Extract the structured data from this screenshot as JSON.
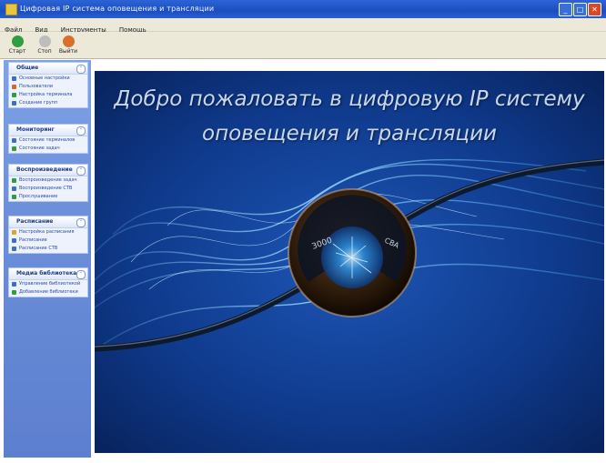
{
  "window": {
    "title": "Цифровая IP система оповещения и трансляции",
    "controls": [
      "minimize",
      "maximize",
      "close"
    ]
  },
  "menu": [
    "Файл",
    "Вид",
    "Инструменты",
    "Помощь"
  ],
  "toolbar": [
    {
      "label": "Старт",
      "icon": "start-icon",
      "color": "#2e9e3e"
    },
    {
      "label": "Стоп",
      "icon": "stop-icon",
      "color": "#b9b9b9"
    },
    {
      "label": "Выйти",
      "icon": "exit-icon",
      "color": "#d9702a"
    }
  ],
  "sidebar": {
    "panels": [
      {
        "title": "Общие",
        "items": [
          {
            "label": "Основные настройки",
            "color": "#3a6fd0"
          },
          {
            "label": "Пользователи",
            "color": "#d36a2a"
          },
          {
            "label": "Настройка терминала",
            "color": "#2e9e3e"
          },
          {
            "label": "Создание групп",
            "color": "#3a6fd0"
          }
        ]
      },
      {
        "title": "Мониторинг",
        "items": [
          {
            "label": "Состояние терминалов",
            "color": "#3a6fd0"
          },
          {
            "label": "Состояние задач",
            "color": "#2e9e3e"
          }
        ]
      },
      {
        "title": "Воспроизведение",
        "items": [
          {
            "label": "Воспроизведение задач",
            "color": "#2e9e3e"
          },
          {
            "label": "Воспроизведение СТВ",
            "color": "#3a6fd0"
          },
          {
            "label": "Прослушивание",
            "color": "#2e9e3e"
          }
        ]
      },
      {
        "title": "Расписание",
        "items": [
          {
            "label": "Настройка расписания",
            "color": "#d9a52a"
          },
          {
            "label": "Расписание",
            "color": "#3a6fd0"
          },
          {
            "label": "Расписание СТВ",
            "color": "#3a6fd0"
          }
        ]
      },
      {
        "title": "Медиа библиотека",
        "items": [
          {
            "label": "Управление библиотекой",
            "color": "#3a6fd0"
          },
          {
            "label": "Добавление библиотеки",
            "color": "#2e9e3e"
          }
        ]
      }
    ]
  },
  "banner": {
    "line1": "Добро пожаловать в цифровую IP систему",
    "line2": "оповещения и трансляции",
    "emblem_text": [
      "3000",
      "CBA"
    ]
  },
  "colors": {
    "titlebar": "#1b4fbf",
    "sidebar": "#6b8fd9",
    "banner_bg": "#0b2f78"
  }
}
